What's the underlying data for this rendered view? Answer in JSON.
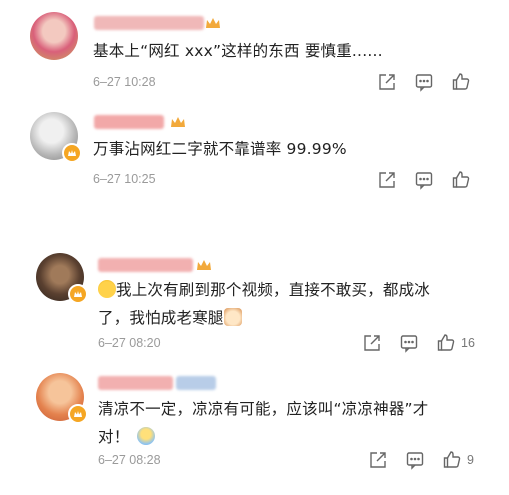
{
  "comments": [
    {
      "username": "████████",
      "text": "基本上“网红 xxx”这样的东西 要慎重......",
      "time": "6–27 10:28",
      "likes": ""
    },
    {
      "username": "███ · ███",
      "text": "万事沾网红二字就不靠谱率 99.99%",
      "time": "6–27 10:25",
      "likes": ""
    },
    {
      "username": "███████",
      "text_line1": "我上次有刷到那个视频，直接不敢买，都成冰",
      "text_line2": "了，我怕成老寒腿",
      "time": "6–27 08:20",
      "likes": "16"
    },
    {
      "username": "██████",
      "text_line1": "清凉不一定，凉凉有可能，应该叫“凉凉神器”才",
      "text_line2": "对！",
      "time": "6–27 08:28",
      "likes": "9"
    }
  ],
  "icons": [
    "share-icon",
    "comment-icon",
    "like-icon"
  ],
  "colors": {
    "badge": "#f5a623",
    "text": "#222222",
    "meta": "#9a9a9a"
  }
}
